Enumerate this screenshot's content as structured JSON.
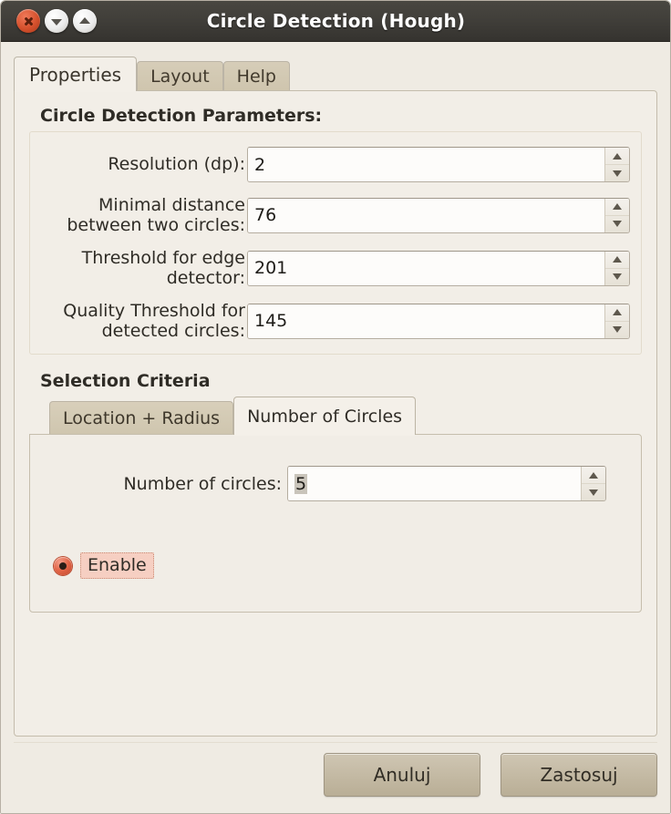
{
  "window": {
    "title": "Circle Detection (Hough)",
    "buttons": {
      "close": "close-window",
      "minimize": "minimize-window",
      "maximize": "maximize-window"
    }
  },
  "tabs": [
    {
      "label": "Properties",
      "active": true
    },
    {
      "label": "Layout",
      "active": false
    },
    {
      "label": "Help",
      "active": false
    }
  ],
  "parameters": {
    "group_title": "Circle Detection Parameters:",
    "fields": [
      {
        "label": "Resolution (dp):",
        "value": "2"
      },
      {
        "label": "Minimal distance between two circles:",
        "value": "76"
      },
      {
        "label": "Threshold for edge detector:",
        "value": "201"
      },
      {
        "label": "Quality Threshold for detected circles:",
        "value": "145"
      }
    ]
  },
  "selection": {
    "group_title": "Selection Criteria",
    "tabs": [
      {
        "label": "Location + Radius",
        "active": false
      },
      {
        "label": "Number of Circles",
        "active": true
      }
    ],
    "count": {
      "label": "Number of circles:",
      "value": "5"
    },
    "enable": {
      "label": "Enable",
      "checked": true
    }
  },
  "actions": {
    "cancel": "Anuluj",
    "apply": "Zastosuj"
  },
  "colors": {
    "titlebar": "#413f3a",
    "dialog_bg": "#efebe3",
    "tab_inactive": "#cfc6af",
    "tab_active": "#f3efe8",
    "radio_accent": "#c2452a",
    "focus_highlight": "#f6cfc2",
    "button_face": "#c4baa4"
  }
}
